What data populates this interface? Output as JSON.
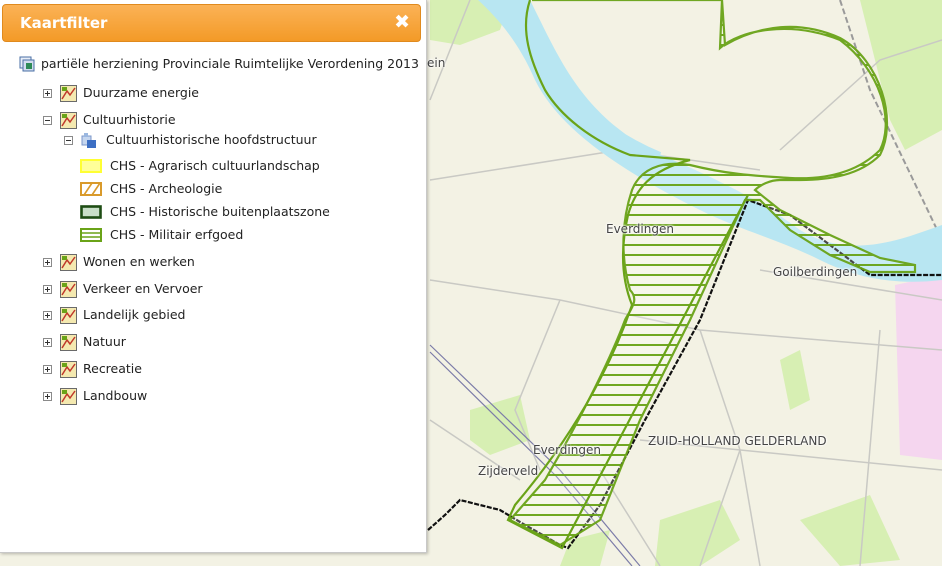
{
  "panel": {
    "title": "Kaartfilter",
    "close_symbol": "✖",
    "root_label": "partiële herziening Provinciale Ruimtelijke Verordening 2013",
    "layers": [
      {
        "label": "Duurzame energie",
        "expanded": false
      },
      {
        "label": "Cultuurhistorie",
        "expanded": true
      },
      {
        "label": "Wonen en werken",
        "expanded": false
      },
      {
        "label": "Verkeer en Vervoer",
        "expanded": false
      },
      {
        "label": "Landelijk gebied",
        "expanded": false
      },
      {
        "label": "Natuur",
        "expanded": false
      },
      {
        "label": "Recreatie",
        "expanded": false
      },
      {
        "label": "Landbouw",
        "expanded": false
      }
    ],
    "sublayer": {
      "label": "Cultuurhistorische hoofdstructuur",
      "expanded": true
    },
    "legend": [
      {
        "label": "CHS - Agrarisch cultuurlandschap",
        "color": "#ffff33",
        "style": "solid-yellow"
      },
      {
        "label": "CHS - Archeologie",
        "color": "#d99a2b",
        "style": "diagonal-orange"
      },
      {
        "label": "CHS - Historische buitenplaatszone",
        "color": "#1e4d14",
        "style": "dark-green-outline"
      },
      {
        "label": "CHS - Militair erfgoed",
        "color": "#6aa318",
        "style": "horizontal-green"
      }
    ]
  },
  "map": {
    "labels": {
      "partial_ein": "ein",
      "everdingen_north": "Everdingen",
      "goilberdingen": "Goilberdingen",
      "everdingen_south": "Everdingen",
      "zijderveld": "Zijderveld",
      "province_border": "ZUID-HOLLAND GELDERLAND"
    },
    "colors": {
      "land": "#f3f2e4",
      "water": "#b8e6f2",
      "green_area": "#d7efb3",
      "urban_pink": "#f5d6ef",
      "hatch_green": "#6aa318",
      "road": "#c9c9c4"
    }
  }
}
